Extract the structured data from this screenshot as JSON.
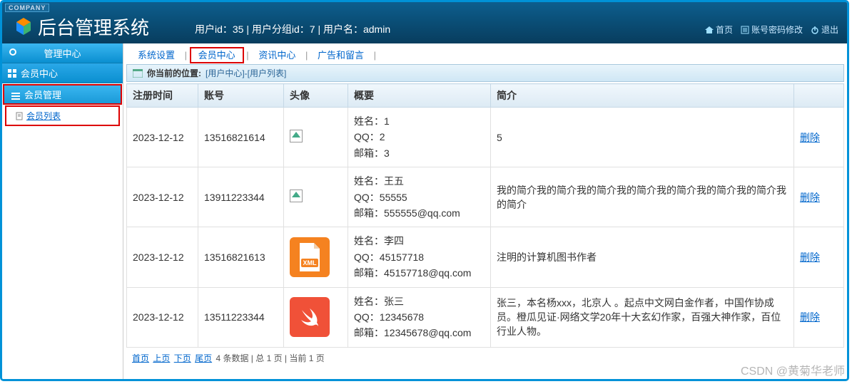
{
  "company_badge": "COMPANY",
  "app_title": "后台管理系统",
  "user_info": "用户id：35 | 用户分组id：7 | 用户名：admin",
  "header_links": {
    "home": "首页",
    "pwd": "账号密码修改",
    "logout": "退出"
  },
  "sidebar": {
    "title": "管理中心",
    "section": "会员中心",
    "subhead": "会员管理",
    "item": "会员列表"
  },
  "tabs": {
    "t1": "系统设置",
    "t2": "会员中心",
    "t3": "资讯中心",
    "t4": "广告和留言"
  },
  "crumb": {
    "label": "你当前的位置:",
    "path": "[用户中心]-[用户列表]"
  },
  "columns": {
    "c1": "注册时间",
    "c2": "账号",
    "c3": "头像",
    "c4": "概要",
    "c5": "简介",
    "c6": ""
  },
  "rows": [
    {
      "date": "2023-12-12",
      "acct": "13516821614",
      "avatar": "broken",
      "summary": "姓名：1\nQQ：2\n邮箱：3",
      "intro": "5",
      "action": "删除"
    },
    {
      "date": "2023-12-12",
      "acct": "13911223344",
      "avatar": "broken",
      "summary": "姓名：王五\nQQ：55555\n邮箱：555555@qq.com",
      "intro": "我的简介我的简介我的简介我的简介我的简介我的简介我的简介我的简介",
      "action": "删除"
    },
    {
      "date": "2023-12-12",
      "acct": "13516821613",
      "avatar": "xml",
      "summary": "姓名：李四\nQQ：45157718\n邮箱：45157718@qq.com",
      "intro": "注明的计算机图书作者",
      "action": "删除"
    },
    {
      "date": "2023-12-12",
      "acct": "13511223344",
      "avatar": "swift",
      "summary": "姓名：张三\nQQ：12345678\n邮箱：12345678@qq.com",
      "intro": "张三，本名杨xxx，北京人 。起点中文网白金作者，中国作协成员。橙瓜见证·网络文学20年十大玄幻作家，百强大神作家，百位行业人物。",
      "action": "删除"
    }
  ],
  "pager": {
    "first": "首页",
    "prev": "上页",
    "next": "下页",
    "last": "尾页",
    "info": "4 条数据 | 总 1 页 | 当前 1 页"
  },
  "watermark": "CSDN @黄菊华老师"
}
